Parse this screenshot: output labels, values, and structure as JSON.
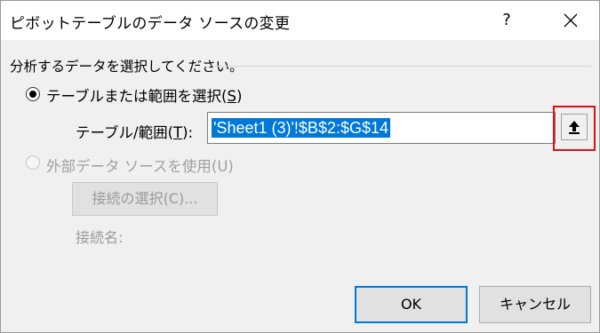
{
  "dialog": {
    "title": "ピボットテーブルのデータ ソースの変更",
    "help_label": "?",
    "close_icon": "close-icon"
  },
  "group": {
    "caption": "分析するデータを選択してください。"
  },
  "table_option": {
    "label": "テーブルまたは範囲を選択(",
    "access_key": "S",
    "label_end": ")",
    "selected": true
  },
  "range": {
    "label": "テーブル/範囲(",
    "access_key": "T",
    "label_end": "):",
    "value": "'Sheet1 (3)'!$B$2:$G$14",
    "collapse_icon": "collapse-dialog-arrow-icon"
  },
  "external_option": {
    "label": "外部データ ソースを使用(U)",
    "selected": false,
    "disabled": true
  },
  "connection": {
    "button_label": "接続の選択(C)...",
    "name_label": "接続名:"
  },
  "buttons": {
    "ok": "OK",
    "cancel": "キャンセル"
  },
  "colors": {
    "selection": "#0078d7",
    "highlight": "#e01010"
  }
}
